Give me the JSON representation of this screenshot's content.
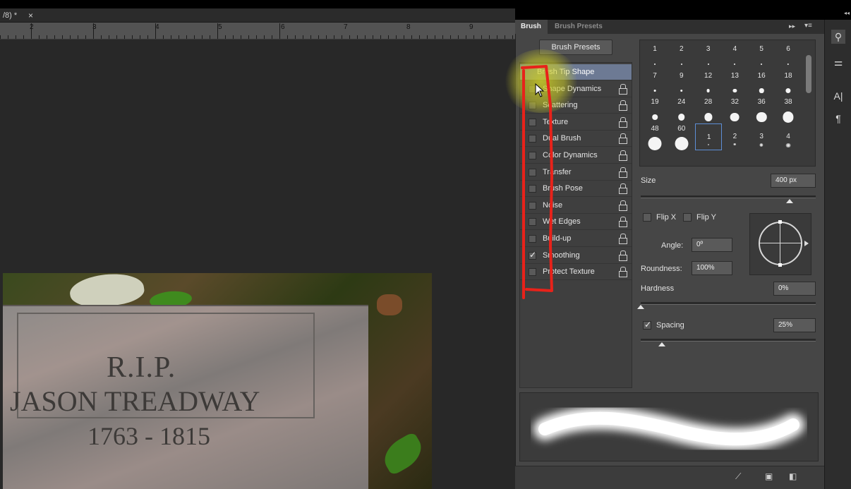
{
  "document": {
    "tab_label": "/8) *",
    "close_glyph": "×",
    "ruler_numbers": [
      "2",
      "3",
      "4",
      "5",
      "6",
      "7",
      "8",
      "9"
    ]
  },
  "photo": {
    "line1": "R.I.P.",
    "line2": "JASON TREADWAY",
    "line3": "1763 - 1815"
  },
  "panel": {
    "tabs": [
      "Brush",
      "Brush Presets"
    ],
    "expand_glyph": "▸▸",
    "menu_glyph": "▾≡",
    "presets_button": "Brush Presets",
    "brush_tip_shape": "Brush Tip Shape",
    "options": [
      {
        "label": "Shape Dynamics",
        "checked": false
      },
      {
        "label": "Scattering",
        "checked": false
      },
      {
        "label": "Texture",
        "checked": false
      },
      {
        "label": "Dual Brush",
        "checked": false
      },
      {
        "label": "Color Dynamics",
        "checked": false
      },
      {
        "label": "Transfer",
        "checked": false
      },
      {
        "label": "Brush Pose",
        "checked": false
      },
      {
        "label": "Noise",
        "checked": false
      },
      {
        "label": "Wet Edges",
        "checked": false
      },
      {
        "label": "Build-up",
        "checked": false
      },
      {
        "label": "Smoothing",
        "checked": true
      },
      {
        "label": "Protect Texture",
        "checked": false
      }
    ],
    "brush_sizes": [
      "1",
      "2",
      "3",
      "4",
      "5",
      "6",
      "7",
      "9",
      "12",
      "13",
      "16",
      "18",
      "19",
      "24",
      "28",
      "32",
      "36",
      "38",
      "48",
      "60",
      "1",
      "2",
      "3",
      "4"
    ],
    "selected_brush_index": 20,
    "size_label": "Size",
    "size_value": "400 px",
    "flip_x_label": "Flip X",
    "flip_y_label": "Flip Y",
    "angle_label": "Angle:",
    "angle_value": "0º",
    "roundness_label": "Roundness:",
    "roundness_value": "100%",
    "hardness_label": "Hardness",
    "hardness_value": "0%",
    "spacing_label": "Spacing",
    "spacing_checked": true,
    "spacing_value": "25%"
  },
  "right_toolbar": {
    "top_glyph": "◂◂",
    "icons": [
      "brush-settings-icon",
      "adjust-icon",
      "character-icon",
      "paragraph-icon"
    ],
    "character_glyph": "A|",
    "paragraph_glyph": "¶"
  },
  "colors": {
    "annotation_red": "#e8221a",
    "highlight_yellow": "#cdcd28",
    "panel_bg": "#464646",
    "active_item": "#6d7a94"
  }
}
